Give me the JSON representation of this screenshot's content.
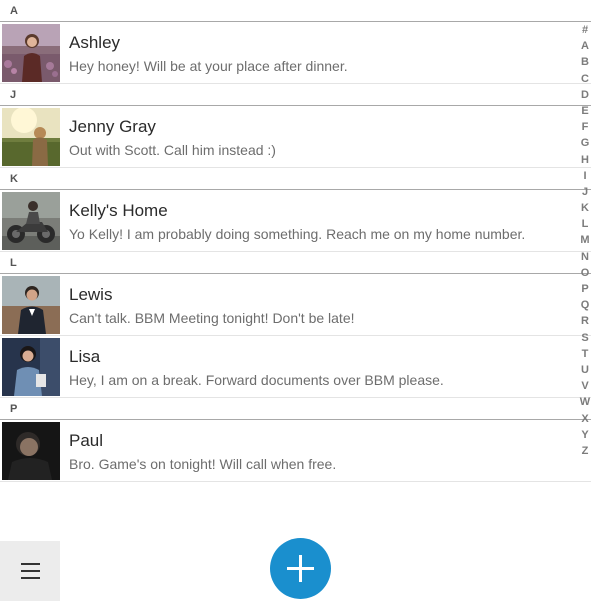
{
  "contacts_list": {
    "sections": [
      {
        "letter": "A",
        "contacts": [
          {
            "name": "Ashley",
            "message": "Hey honey! Will be at your place after dinner."
          }
        ]
      },
      {
        "letter": "J",
        "contacts": [
          {
            "name": "Jenny Gray",
            "message": "Out with Scott. Call him instead :)"
          }
        ]
      },
      {
        "letter": "K",
        "contacts": [
          {
            "name": "Kelly's Home",
            "message": "Yo Kelly! I am probably doing something. Reach me on my home number."
          }
        ]
      },
      {
        "letter": "L",
        "contacts": [
          {
            "name": "Lewis",
            "message": "Can't talk. BBM Meeting tonight! Don't be late!"
          },
          {
            "name": "Lisa",
            "message": "Hey, I am on a break. Forward documents over BBM please."
          }
        ]
      },
      {
        "letter": "P",
        "contacts": [
          {
            "name": "Paul",
            "message": "Bro. Game's on tonight! Will call when free."
          }
        ]
      }
    ]
  },
  "alphabet_index": [
    "#",
    "A",
    "B",
    "C",
    "D",
    "E",
    "F",
    "G",
    "H",
    "I",
    "J",
    "K",
    "L",
    "M",
    "N",
    "O",
    "P",
    "Q",
    "R",
    "S",
    "T",
    "U",
    "V",
    "W",
    "X",
    "Y",
    "Z"
  ],
  "toolbar": {
    "menu_icon": "hamburger-menu-icon",
    "add_icon": "plus-icon",
    "accent_color": "#1a8fce"
  }
}
